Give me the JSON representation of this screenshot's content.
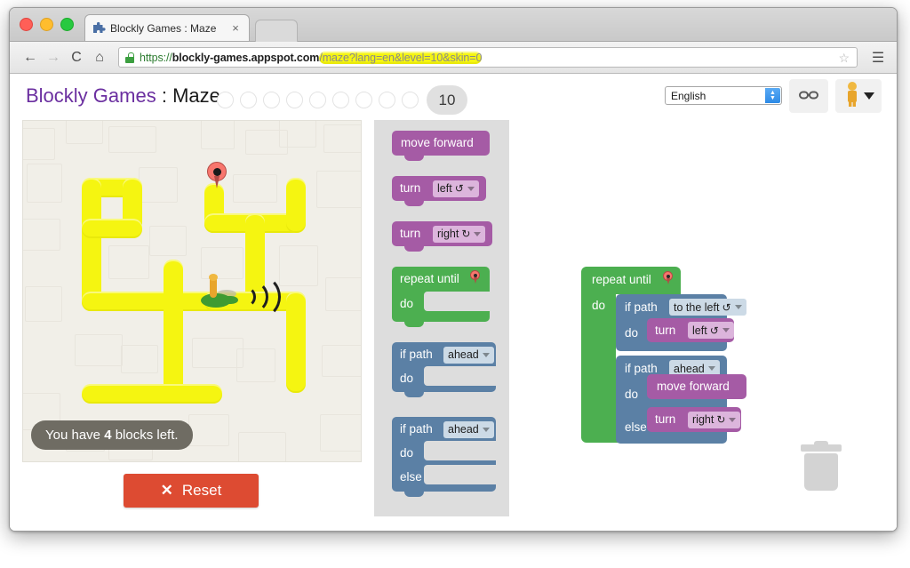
{
  "browser": {
    "tab": {
      "title": "Blockly Games : Maze",
      "favicon": "blockly-puzzle-icon",
      "close_label": "×"
    },
    "nav": {
      "back_icon": "←",
      "forward_icon": "→",
      "reload_icon": "C",
      "home_icon": "⌂",
      "menu_icon": "☰",
      "star_icon": "☆"
    },
    "url": {
      "scheme": "https://",
      "host": "blockly-games.appspot.com",
      "path": "/maze?lang=en&level=10&skin=0",
      "secure": true
    }
  },
  "header": {
    "brand": "Blockly Games",
    "separator": " : ",
    "section": "Maze",
    "levels": {
      "completed_dots": 9,
      "current": "10"
    },
    "language": {
      "value": "English"
    },
    "link_button_label": "꒬",
    "avatar_label": "pegman-avatar"
  },
  "maze": {
    "status_prefix": "You have ",
    "status_count": "4",
    "status_suffix": " blocks left.",
    "marker_icon": "map-pin-icon",
    "player_icon": "pegman-sprite"
  },
  "reset": {
    "icon": "✕",
    "label": "Reset"
  },
  "toolbox": {
    "blocks": [
      {
        "type": "move",
        "label": "move forward"
      },
      {
        "type": "turn",
        "label": "turn",
        "field": "left",
        "rot": "↺"
      },
      {
        "type": "turn",
        "label": "turn",
        "field": "right",
        "rot": "↻"
      },
      {
        "type": "repeat",
        "label": "repeat until",
        "do_label": "do"
      },
      {
        "type": "if",
        "label": "if path",
        "field": "ahead",
        "do_label": "do"
      },
      {
        "type": "ifelse",
        "label": "if path",
        "field": "ahead",
        "do_label": "do",
        "else_label": "else"
      }
    ]
  },
  "workspace": {
    "repeat": {
      "label": "repeat until",
      "do_label": "do"
    },
    "if1": {
      "label": "if path",
      "field": "to the left",
      "rot": "↺",
      "do_label": "do"
    },
    "turn_left": {
      "label": "turn",
      "field": "left",
      "rot": "↺"
    },
    "if2": {
      "label": "if path",
      "field": "ahead",
      "do_label": "do",
      "else_label": "else"
    },
    "move": {
      "label": "move forward"
    },
    "turn_right": {
      "label": "turn",
      "field": "right",
      "rot": "↻"
    }
  },
  "trash": {
    "label": "trash-can"
  },
  "colors": {
    "brand_purple": "#6b2fa0",
    "block_purple": "#a55ba5",
    "block_green": "#4caf50",
    "block_blue": "#5b80a5",
    "maze_path": "#f5f511",
    "maze_bg": "#f1efe8",
    "reset_red": "#dd4b32",
    "status_gray": "#6f6c63"
  }
}
